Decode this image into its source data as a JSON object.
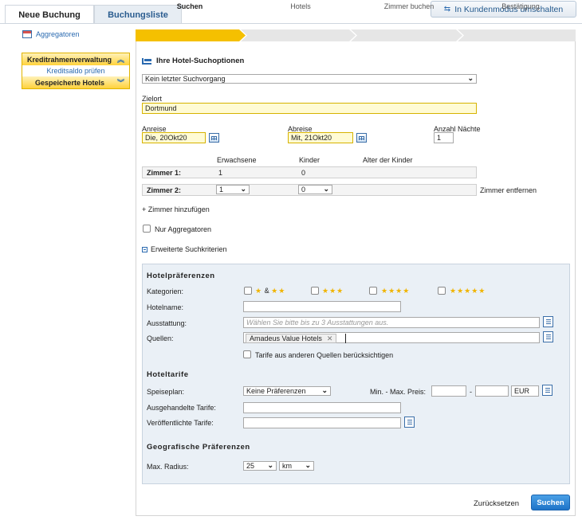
{
  "tabs": {
    "new_booking": "Neue Buchung",
    "booking_list": "Buchungsliste"
  },
  "customer_mode": "In Kundenmodus umschalten",
  "sidebar": {
    "aggregators": "Aggregatoren",
    "credit_header": "Kreditrahmenverwaltung",
    "credit_link": "Kreditsaldo prüfen",
    "saved_hotels": "Gespeicherte Hotels"
  },
  "steps": [
    "Suchen",
    "Hotels",
    "Zimmer buchen",
    "Bestätigung"
  ],
  "form": {
    "section_title": "Ihre Hotel-Suchoptionen",
    "last_search": "Kein letzter Suchvorgang",
    "dest_label": "Zielort",
    "dest_value": "Dortmund",
    "arrival_label": "Anreise",
    "arrival_value": "Die, 20Okt20",
    "departure_label": "Abreise",
    "departure_value": "Mit, 21Okt20",
    "nights_label": "Anzahl Nächte",
    "nights_value": "1",
    "col_adults": "Erwachsene",
    "col_children": "Kinder",
    "col_child_age": "Alter der Kinder",
    "room1_label": "Zimmer 1:",
    "room1_adults": "1",
    "room1_children": "0",
    "room2_label": "Zimmer 2:",
    "room2_adults": "1",
    "room2_children": "0",
    "remove_room": "Zimmer entfernen",
    "add_room": "+ Zimmer hinzufügen",
    "only_aggregators": "Nur Aggregatoren",
    "advanced": "Erweiterte Suchkriterien"
  },
  "advanced": {
    "hotel_prefs": "Hotelpräferenzen",
    "categories_label": "Kategorien:",
    "cat1_amp": "&",
    "hotelname_label": "Hotelname:",
    "amenities_label": "Ausstattung:",
    "amenities_placeholder": "Wählen Sie bitte bis zu 3 Ausstattungen aus.",
    "sources_label": "Quellen:",
    "source_token": "Amadeus Value Hotels",
    "other_sources": "Tarife aus anderen Quellen berücksichtigen",
    "rates_title": "Hoteltarife",
    "meal_label": "Speiseplan:",
    "meal_value": "Keine Präferenzen",
    "price_label": "Min. - Max. Preis:",
    "price_sep": "-",
    "currency": "EUR",
    "negotiated_label": "Ausgehandelte Tarife:",
    "published_label": "Veröffentlichte Tarife:",
    "geo_title": "Geografische Präferenzen",
    "radius_label": "Max. Radius:",
    "radius_value": "25",
    "radius_unit": "km"
  },
  "actions": {
    "reset": "Zurücksetzen",
    "search": "Suchen"
  },
  "colors": {
    "accent": "#f5c000",
    "link": "#2a6ab0",
    "primary_button": "#1e73c8"
  }
}
